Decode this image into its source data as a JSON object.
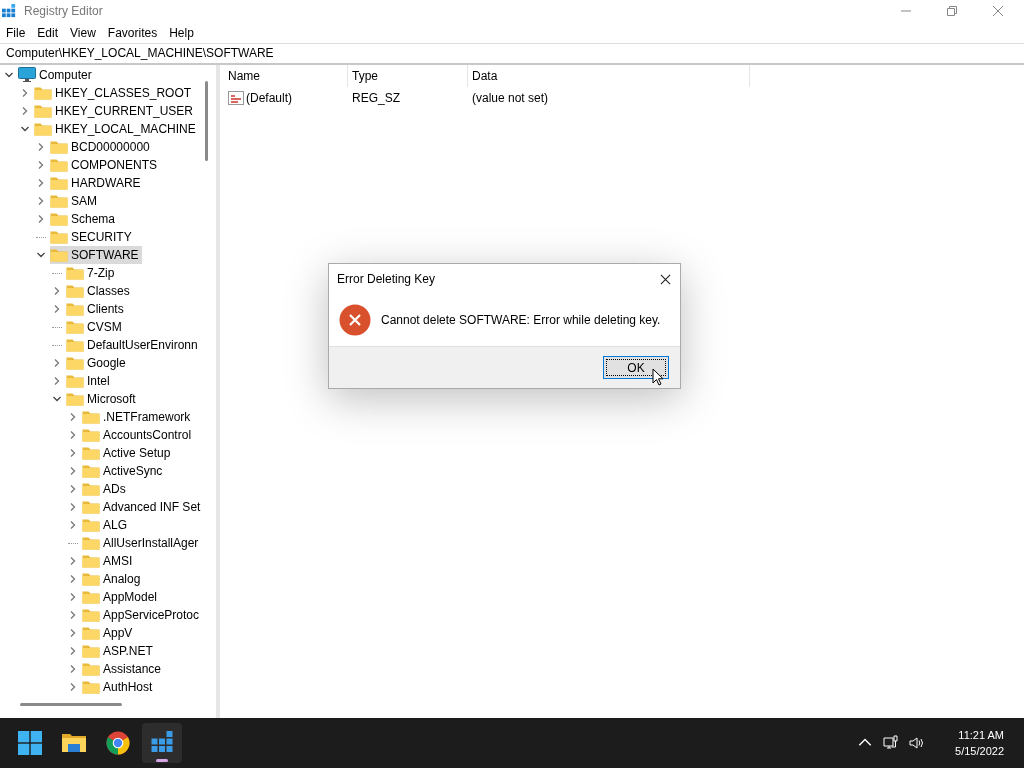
{
  "window": {
    "title": "Registry Editor"
  },
  "menu": [
    "File",
    "Edit",
    "View",
    "Favorites",
    "Help"
  ],
  "address": "Computer\\HKEY_LOCAL_MACHINE\\SOFTWARE",
  "tree": [
    {
      "name": "Computer",
      "kind": "root",
      "expanded": true,
      "selected": false,
      "children": [
        {
          "name": "HKEY_CLASSES_ROOT",
          "kind": "branch",
          "expanded": false,
          "selected": false
        },
        {
          "name": "HKEY_CURRENT_USER",
          "kind": "branch",
          "expanded": false,
          "selected": false
        },
        {
          "name": "HKEY_LOCAL_MACHINE",
          "kind": "branch",
          "expanded": true,
          "selected": false,
          "children": [
            {
              "name": "BCD00000000",
              "kind": "branch",
              "expanded": false,
              "selected": false
            },
            {
              "name": "COMPONENTS",
              "kind": "branch",
              "expanded": false,
              "selected": false
            },
            {
              "name": "HARDWARE",
              "kind": "branch",
              "expanded": false,
              "selected": false
            },
            {
              "name": "SAM",
              "kind": "branch",
              "expanded": false,
              "selected": false
            },
            {
              "name": "Schema",
              "kind": "branch",
              "expanded": false,
              "selected": false
            },
            {
              "name": "SECURITY",
              "kind": "leaf",
              "selected": false
            },
            {
              "name": "SOFTWARE",
              "kind": "branch",
              "expanded": true,
              "selected": true,
              "children": [
                {
                  "name": "7-Zip",
                  "kind": "leaf",
                  "selected": false
                },
                {
                  "name": "Classes",
                  "kind": "branch",
                  "expanded": false,
                  "selected": false
                },
                {
                  "name": "Clients",
                  "kind": "branch",
                  "expanded": false,
                  "selected": false
                },
                {
                  "name": "CVSM",
                  "kind": "leaf",
                  "selected": false
                },
                {
                  "name": "DefaultUserEnvironn",
                  "kind": "leaf",
                  "selected": false
                },
                {
                  "name": "Google",
                  "kind": "branch",
                  "expanded": false,
                  "selected": false
                },
                {
                  "name": "Intel",
                  "kind": "branch",
                  "expanded": false,
                  "selected": false
                },
                {
                  "name": "Microsoft",
                  "kind": "branch",
                  "expanded": true,
                  "selected": false,
                  "children": [
                    {
                      "name": ".NETFramework",
                      "kind": "branch",
                      "expanded": false,
                      "selected": false
                    },
                    {
                      "name": "AccountsControl",
                      "kind": "branch",
                      "expanded": false,
                      "selected": false
                    },
                    {
                      "name": "Active Setup",
                      "kind": "branch",
                      "expanded": false,
                      "selected": false
                    },
                    {
                      "name": "ActiveSync",
                      "kind": "branch",
                      "expanded": false,
                      "selected": false
                    },
                    {
                      "name": "ADs",
                      "kind": "branch",
                      "expanded": false,
                      "selected": false
                    },
                    {
                      "name": "Advanced INF Set",
                      "kind": "branch",
                      "expanded": false,
                      "selected": false
                    },
                    {
                      "name": "ALG",
                      "kind": "branch",
                      "expanded": false,
                      "selected": false
                    },
                    {
                      "name": "AllUserInstallAger",
                      "kind": "leaf",
                      "selected": false
                    },
                    {
                      "name": "AMSI",
                      "kind": "branch",
                      "expanded": false,
                      "selected": false
                    },
                    {
                      "name": "Analog",
                      "kind": "branch",
                      "expanded": false,
                      "selected": false
                    },
                    {
                      "name": "AppModel",
                      "kind": "branch",
                      "expanded": false,
                      "selected": false
                    },
                    {
                      "name": "AppServiceProtoc",
                      "kind": "branch",
                      "expanded": false,
                      "selected": false
                    },
                    {
                      "name": "AppV",
                      "kind": "branch",
                      "expanded": false,
                      "selected": false
                    },
                    {
                      "name": "ASP.NET",
                      "kind": "branch",
                      "expanded": false,
                      "selected": false
                    },
                    {
                      "name": "Assistance",
                      "kind": "branch",
                      "expanded": false,
                      "selected": false
                    },
                    {
                      "name": "AuthHost",
                      "kind": "branch",
                      "expanded": false,
                      "selected": false
                    }
                  ]
                }
              ]
            }
          ]
        }
      ]
    }
  ],
  "values_table": {
    "columns": [
      "Name",
      "Type",
      "Data"
    ],
    "rows": [
      {
        "name": "(Default)",
        "type": "REG_SZ",
        "data": "(value not set)"
      }
    ]
  },
  "dialog": {
    "title": "Error Deleting Key",
    "message": "Cannot delete SOFTWARE:  Error while deleting key.",
    "button": "OK"
  },
  "taskbar": {
    "apps": [
      {
        "kind": "start",
        "selected": false
      },
      {
        "kind": "explorer",
        "selected": false
      },
      {
        "kind": "chrome",
        "selected": false
      },
      {
        "kind": "regedit",
        "selected": true
      }
    ],
    "time": "11:21 AM",
    "date": "5/15/2022"
  }
}
